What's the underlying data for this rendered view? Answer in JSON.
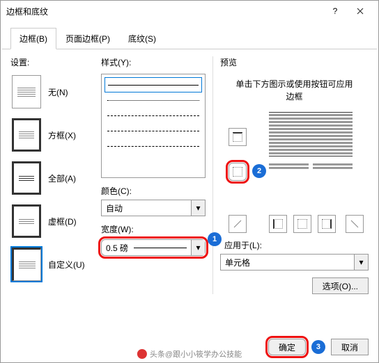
{
  "title": "边框和底纹",
  "tabs": {
    "border": "边框(B)",
    "pageBorder": "页面边框(P)",
    "shading": "底纹(S)"
  },
  "settings": {
    "label": "设置:",
    "options": {
      "none": "无(N)",
      "box": "方框(X)",
      "all": "全部(A)",
      "grid": "虚框(D)",
      "custom": "自定义(U)"
    }
  },
  "style": {
    "label": "样式(Y):"
  },
  "color": {
    "label": "颜色(C):",
    "value": "自动"
  },
  "width": {
    "label": "宽度(W):",
    "value": "0.5 磅"
  },
  "preview": {
    "label": "预览",
    "hint": "单击下方图示或使用按钮可应用边框"
  },
  "applyTo": {
    "label": "应用于(L):",
    "value": "单元格"
  },
  "options": "选项(O)...",
  "ok": "确定",
  "cancel": "取消",
  "watermark": "头条@跟小小筱学办公技能",
  "markers": {
    "m1": "1",
    "m2": "2",
    "m3": "3"
  }
}
